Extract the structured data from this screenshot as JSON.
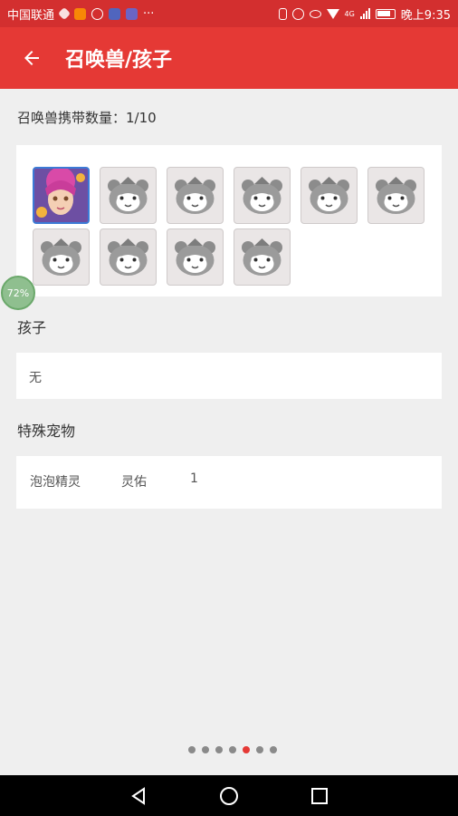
{
  "status_bar": {
    "carrier": "中国联通",
    "more_indicator": "···",
    "network": "4G",
    "time": "晚上9:35",
    "icons": [
      "carrier-icon",
      "notification-icon",
      "app-icon",
      "tieba-icon",
      "app-icon-2",
      "vibrate-icon",
      "alarm-icon",
      "eye-icon",
      "wifi-icon",
      "signal-icon",
      "battery-icon"
    ]
  },
  "appbar": {
    "title": "召唤兽/孩子",
    "back_icon": "arrow-left-icon"
  },
  "pets": {
    "count_label": "召唤兽携带数量：1/10",
    "slots": [
      {
        "type": "avatar",
        "selected": true
      },
      {
        "type": "placeholder"
      },
      {
        "type": "placeholder"
      },
      {
        "type": "placeholder"
      },
      {
        "type": "placeholder"
      },
      {
        "type": "placeholder"
      },
      {
        "type": "placeholder"
      },
      {
        "type": "placeholder"
      },
      {
        "type": "placeholder"
      },
      {
        "type": "placeholder"
      }
    ]
  },
  "progress_bubble": "72%",
  "children": {
    "title": "孩子",
    "value": "无"
  },
  "special_pets": {
    "title": "特殊宠物",
    "items": [
      {
        "name": "泡泡精灵",
        "type": "灵佑",
        "count": "1"
      }
    ]
  },
  "pager": {
    "total": 7,
    "active": 4
  },
  "colors": {
    "accent": "#e53935",
    "status_bar": "#d32f2f",
    "selected_border": "#3c7bd6"
  },
  "nav": {
    "back_icon": "nav-back-icon",
    "home_icon": "nav-home-icon",
    "recents_icon": "nav-recents-icon"
  }
}
